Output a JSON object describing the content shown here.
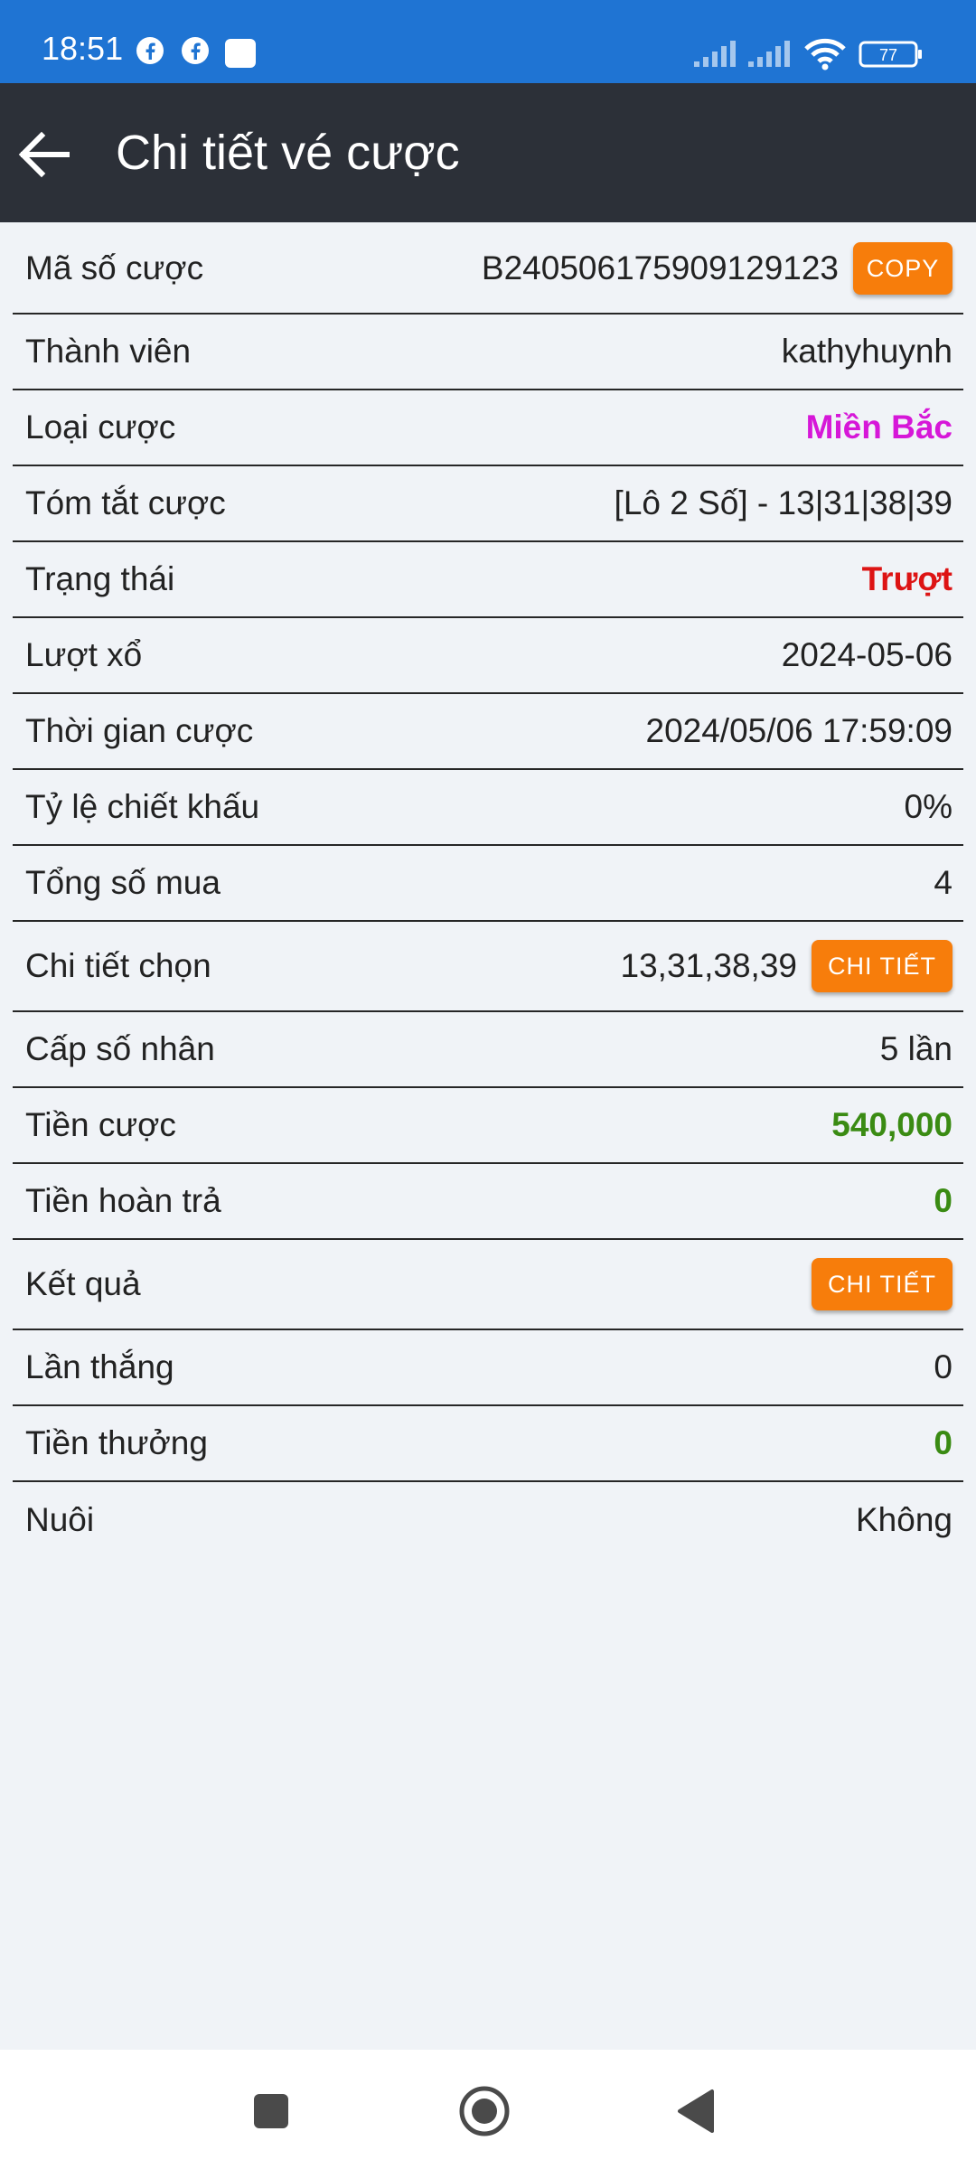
{
  "status_bar": {
    "time": "18:51",
    "icons": [
      "facebook-icon",
      "facebook-icon",
      "notification-square-icon",
      "signal-icon",
      "signal-icon",
      "wifi-icon",
      "battery-icon"
    ],
    "battery": "77"
  },
  "app_bar": {
    "back_icon": "arrow-left-icon",
    "title": "Chi tiết vé cược"
  },
  "rows": [
    {
      "label": "Mã số cược",
      "value": "B240506175909129123",
      "button": "COPY"
    },
    {
      "label": "Thành viên",
      "value": "kathyhuynh"
    },
    {
      "label": "Loại cược",
      "value": "Miền Bắc",
      "color": "#d617d8"
    },
    {
      "label": "Tóm tắt cược",
      "value": "[Lô 2 Số] - 13|31|38|39"
    },
    {
      "label": "Trạng thái",
      "value": "Trượt",
      "color": "#dd1414"
    },
    {
      "label": "Lượt xổ",
      "value": "2024-05-06"
    },
    {
      "label": "Thời gian cược",
      "value": "2024/05/06 17:59:09"
    },
    {
      "label": "Tỷ lệ chiết khấu",
      "value": "0%"
    },
    {
      "label": "Tổng số mua",
      "value": "4"
    },
    {
      "label": "Chi tiết chọn",
      "value": "13,31,38,39",
      "button": "CHI TIẾT"
    },
    {
      "label": "Cấp số nhân",
      "value": "5 lần"
    },
    {
      "label": "Tiền cược",
      "value": "540,000",
      "color": "#3a8b13"
    },
    {
      "label": "Tiền hoàn trả",
      "value": "0",
      "color": "#3a8b13"
    },
    {
      "label": "Kết quả",
      "value": "",
      "button": "CHI TIẾT"
    },
    {
      "label": "Lần thắng",
      "value": "0"
    },
    {
      "label": "Tiền thưởng",
      "value": "0",
      "color": "#3a8b13"
    },
    {
      "label": "Nuôi",
      "value": "Không"
    }
  ],
  "nav_bar": {
    "icons": [
      "recents-square-icon",
      "home-circle-icon",
      "back-triangle-icon"
    ]
  },
  "colors": {
    "status_bar": "#1f74d3",
    "app_bar": "#2c3038",
    "accent_button": "#f77d0b",
    "background": "#f0f3f7"
  }
}
